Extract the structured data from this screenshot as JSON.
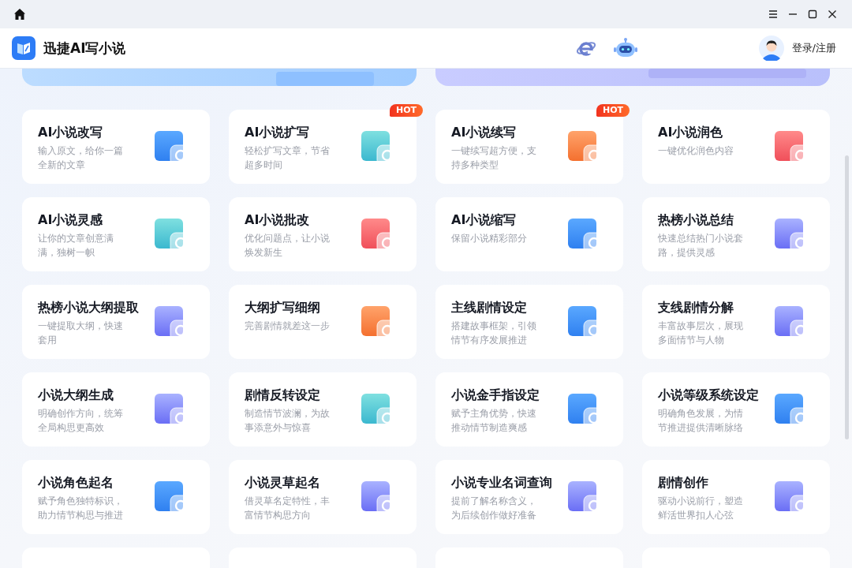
{
  "app": {
    "title": "迅捷AI写小说"
  },
  "account": {
    "label": "登录/注册"
  },
  "tool_rows": [
    {
      "tools": [
        {
          "title": "AI小说改写",
          "description": "输入原文，给你一篇全新的文章"
        },
        {
          "title": "AI小说扩写",
          "description": "轻松扩写文章，节省超多时间",
          "badge": "HOT"
        },
        {
          "title": "AI小说续写",
          "description": "一键续写超方便，支持多种类型",
          "badge": "HOT"
        },
        {
          "title": "AI小说润色",
          "description": "一键优化润色内容"
        }
      ]
    },
    {
      "tools": [
        {
          "title": "AI小说灵感",
          "description": "让你的文章创意满满，独树一帜"
        },
        {
          "title": "AI小说批改",
          "description": "优化问题点，让小说焕发新生"
        },
        {
          "title": "AI小说缩写",
          "description": "保留小说精彩部分"
        },
        {
          "title": "热榜小说总结",
          "description": "快速总结热门小说套路，提供灵感"
        }
      ]
    },
    {
      "tools": [
        {
          "title": "热榜小说大纲提取",
          "description": "一键提取大纲，快速套用"
        },
        {
          "title": "大纲扩写细纲",
          "description": "完善剧情就差这一步"
        },
        {
          "title": "主线剧情设定",
          "description": "搭建故事框架，引领情节有序发展推进"
        },
        {
          "title": "支线剧情分解",
          "description": "丰富故事层次，展现多面情节与人物"
        }
      ]
    },
    {
      "tools": [
        {
          "title": "小说大纲生成",
          "description": "明确创作方向，统筹全局构思更高效"
        },
        {
          "title": "剧情反转设定",
          "description": "制造情节波澜，为故事添意外与惊喜"
        },
        {
          "title": "小说金手指设定",
          "description": "赋予主角优势，快速推动情节制造爽感"
        },
        {
          "title": "小说等级系统设定",
          "description": "明确角色发展，为情节推进提供清晰脉络"
        }
      ]
    },
    {
      "tools": [
        {
          "title": "小说角色起名",
          "description": "赋予角色独特标识，助力情节构思与推进"
        },
        {
          "title": "小说灵草起名",
          "description": "借灵草名定特性，丰富情节构思方向"
        },
        {
          "title": "小说专业名词查询",
          "description": "提前了解名称含义，为后续创作做好准备"
        },
        {
          "title": "剧情创作",
          "description": "驱动小说前行，塑造鲜活世界扣人心弦"
        }
      ]
    }
  ]
}
